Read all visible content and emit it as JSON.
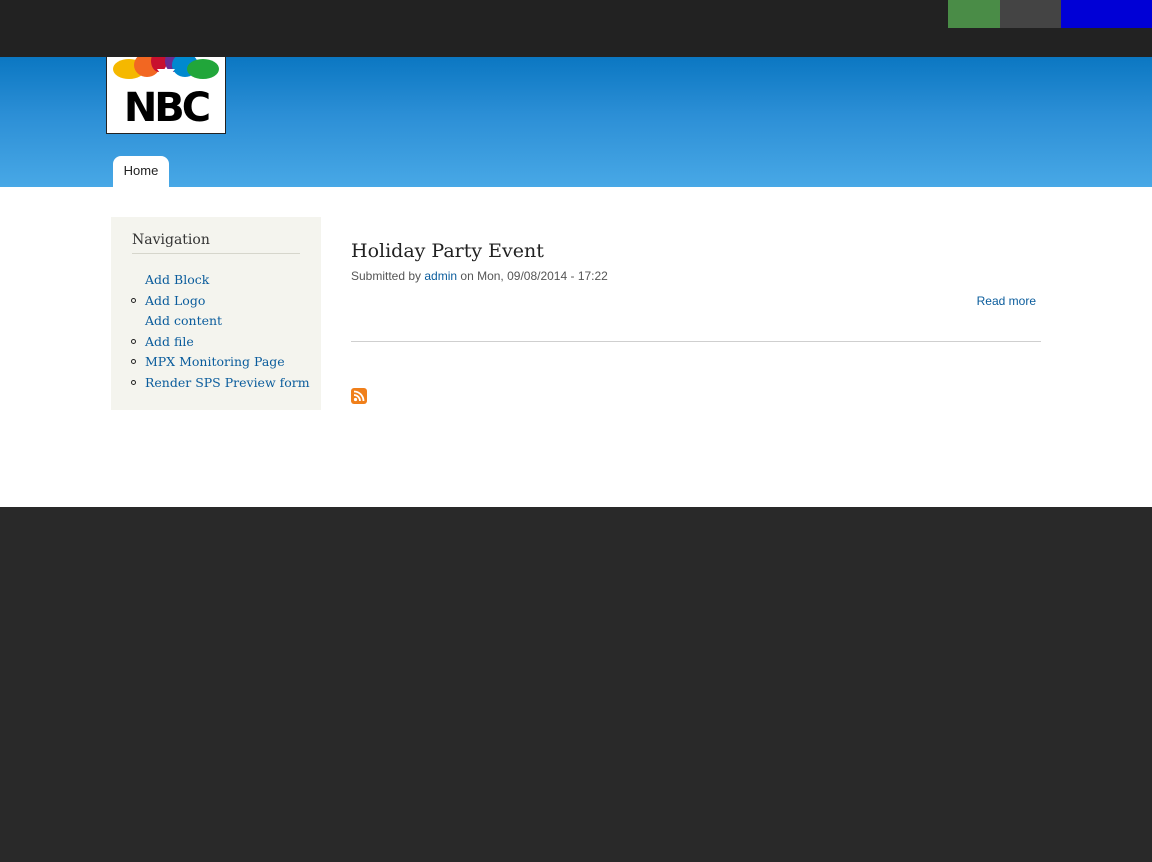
{
  "toolbar": {
    "colors": [
      "#4a8c47",
      "#444444",
      "#0000d6"
    ]
  },
  "header": {
    "logo": {
      "text": "NBC",
      "icon": "nbc-peacock-logo"
    },
    "tabs": [
      {
        "label": "Home",
        "active": true
      }
    ],
    "gradient": [
      "#0b77c2",
      "#48a8e6"
    ]
  },
  "sidebar": {
    "title": "Navigation",
    "items": [
      {
        "label": "Add Block",
        "bullet": false
      },
      {
        "label": "Add Logo",
        "bullet": true
      },
      {
        "label": "Add content",
        "bullet": false
      },
      {
        "label": "Add file",
        "bullet": true
      },
      {
        "label": "MPX Monitoring Page",
        "bullet": true
      },
      {
        "label": "Render SPS Preview form",
        "bullet": true
      }
    ]
  },
  "main": {
    "node": {
      "title": "Holiday Party Event",
      "submitted_prefix": "Submitted by ",
      "author": "admin",
      "submitted_suffix": " on Mon, 09/08/2014 - 17:22",
      "read_more": "Read more"
    },
    "feed_icon": "rss-feed-icon"
  },
  "colors": {
    "link": "#0a5c9c",
    "page_background": "#292929",
    "toolbar": "#222222"
  }
}
